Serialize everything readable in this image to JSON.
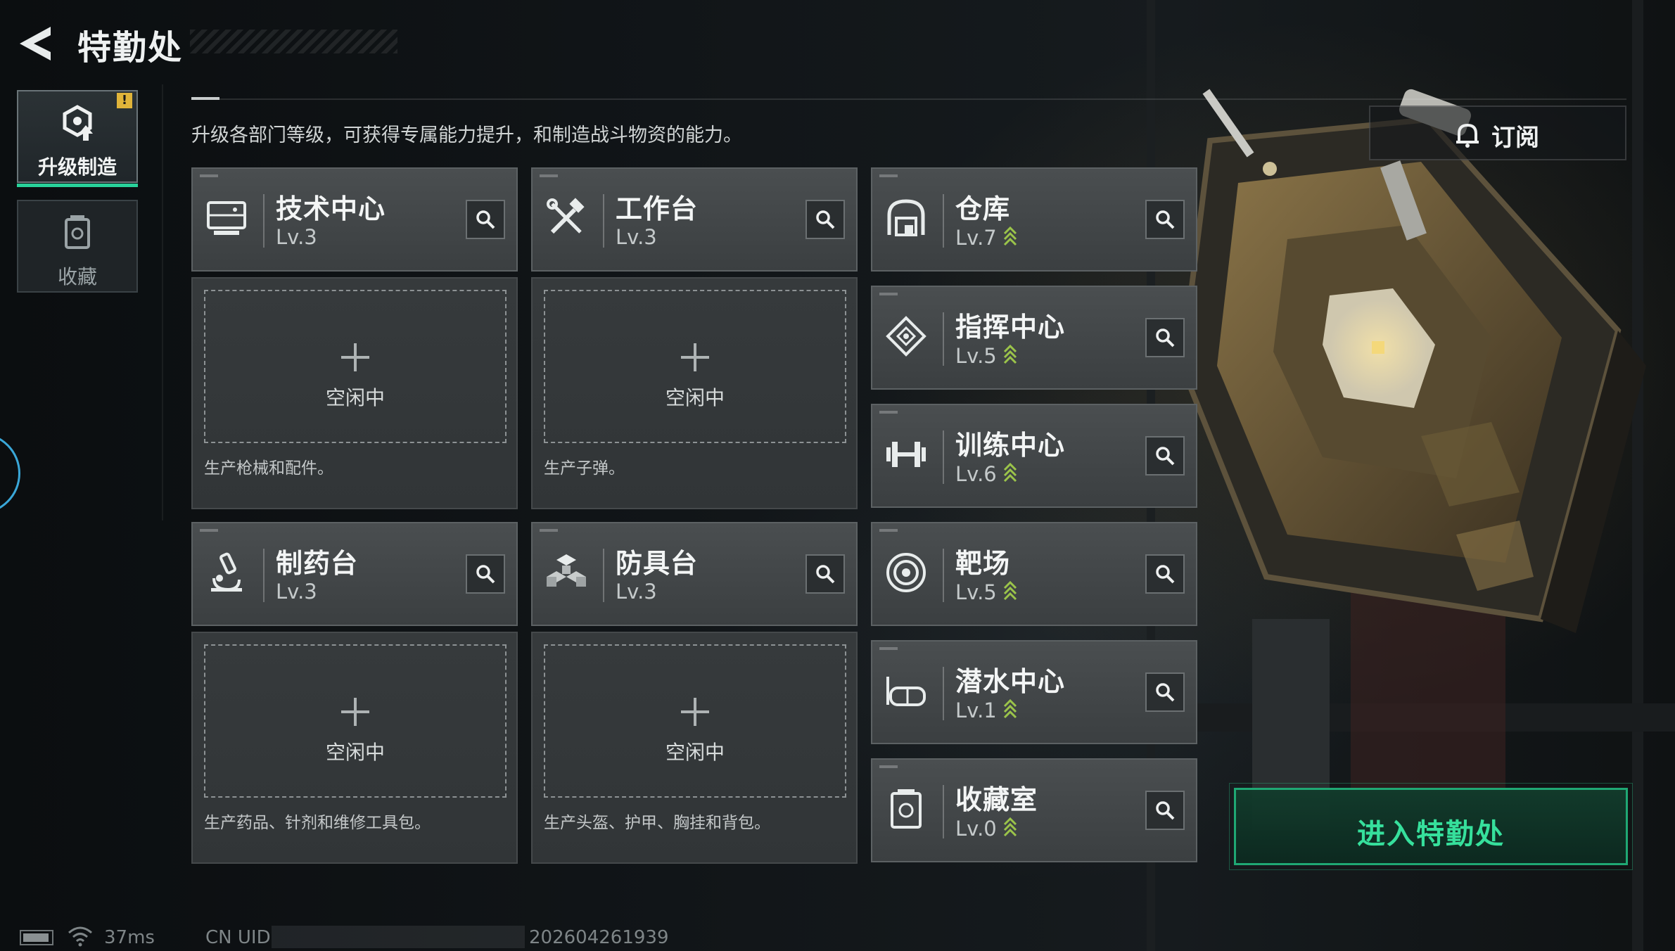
{
  "header": {
    "title": "特勤处"
  },
  "sidebar": {
    "tabs": [
      {
        "label": "升级制造",
        "badge": "!"
      },
      {
        "label": "收藏"
      }
    ]
  },
  "description": "升级各部门等级，可获得专属能力提升，和制造战斗物资的能力。",
  "subscribe": {
    "label": "订阅"
  },
  "production_departments": [
    {
      "name": "技术中心",
      "level": "Lv.3",
      "status": "空闲中",
      "desc": "生产枪械和配件。",
      "icon": "monitor-icon"
    },
    {
      "name": "工作台",
      "level": "Lv.3",
      "status": "空闲中",
      "desc": "生产子弹。",
      "icon": "tools-icon"
    },
    {
      "name": "制药台",
      "level": "Lv.3",
      "status": "空闲中",
      "desc": "生产药品、针剂和维修工具包。",
      "icon": "microscope-icon"
    },
    {
      "name": "防具台",
      "level": "Lv.3",
      "status": "空闲中",
      "desc": "生产头盔、护甲、胸挂和背包。",
      "icon": "boxes-icon"
    }
  ],
  "other_departments": [
    {
      "name": "仓库",
      "level": "Lv.7",
      "upgradable": true,
      "icon": "warehouse-icon"
    },
    {
      "name": "指挥中心",
      "level": "Lv.5",
      "upgradable": true,
      "icon": "command-icon"
    },
    {
      "name": "训练中心",
      "level": "Lv.6",
      "upgradable": true,
      "icon": "dumbbell-icon"
    },
    {
      "name": "靶场",
      "level": "Lv.5",
      "upgradable": true,
      "icon": "target-icon"
    },
    {
      "name": "潜水中心",
      "level": "Lv.1",
      "upgradable": true,
      "icon": "diving-mask-icon"
    },
    {
      "name": "收藏室",
      "level": "Lv.0",
      "upgradable": true,
      "icon": "collection-icon"
    }
  ],
  "enter_button": {
    "label": "进入特勤处"
  },
  "status_bar": {
    "ping": "37ms",
    "uid_label": "CN UID",
    "timestamp": "202604261939"
  },
  "colors": {
    "accent_green": "#36e09c",
    "badge_yellow": "#e0b43a",
    "card_bg": "#45494b"
  }
}
